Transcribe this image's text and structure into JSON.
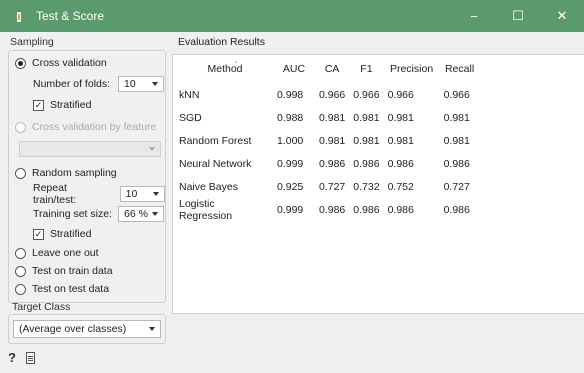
{
  "window": {
    "title": "Test & Score",
    "minimize": "−",
    "maximize": "☐",
    "close": "✕"
  },
  "sampling": {
    "label": "Sampling",
    "cross_validation": "Cross validation",
    "folds_label": "Number of folds:",
    "folds_value": "10",
    "stratified_label": "Stratified",
    "cv_by_feature": "Cross validation by feature",
    "random_sampling": "Random sampling",
    "repeat_label": "Repeat train/test:",
    "repeat_value": "10",
    "training_label": "Training set size:",
    "training_value": "66 %",
    "stratified2_label": "Stratified",
    "leave_one_out": "Leave one out",
    "test_on_train": "Test on train data",
    "test_on_test": "Test on test data"
  },
  "target": {
    "label": "Target Class",
    "value": "(Average over classes)"
  },
  "results": {
    "label": "Evaluation Results",
    "columns": [
      "Method",
      "AUC",
      "CA",
      "F1",
      "Precision",
      "Recall"
    ],
    "rows": [
      [
        "kNN",
        "0.998",
        "0.966",
        "0.966",
        "0.966",
        "0.966"
      ],
      [
        "SGD",
        "0.988",
        "0.981",
        "0.981",
        "0.981",
        "0.981"
      ],
      [
        "Random Forest",
        "1.000",
        "0.981",
        "0.981",
        "0.981",
        "0.981"
      ],
      [
        "Neural Network",
        "0.999",
        "0.986",
        "0.986",
        "0.986",
        "0.986"
      ],
      [
        "Naive Bayes",
        "0.925",
        "0.727",
        "0.732",
        "0.752",
        "0.727"
      ],
      [
        "Logistic Regression",
        "0.999",
        "0.986",
        "0.986",
        "0.986",
        "0.986"
      ]
    ]
  },
  "footer": {
    "help": "?"
  },
  "colors": {
    "titlebar": "#5b9a6c"
  }
}
